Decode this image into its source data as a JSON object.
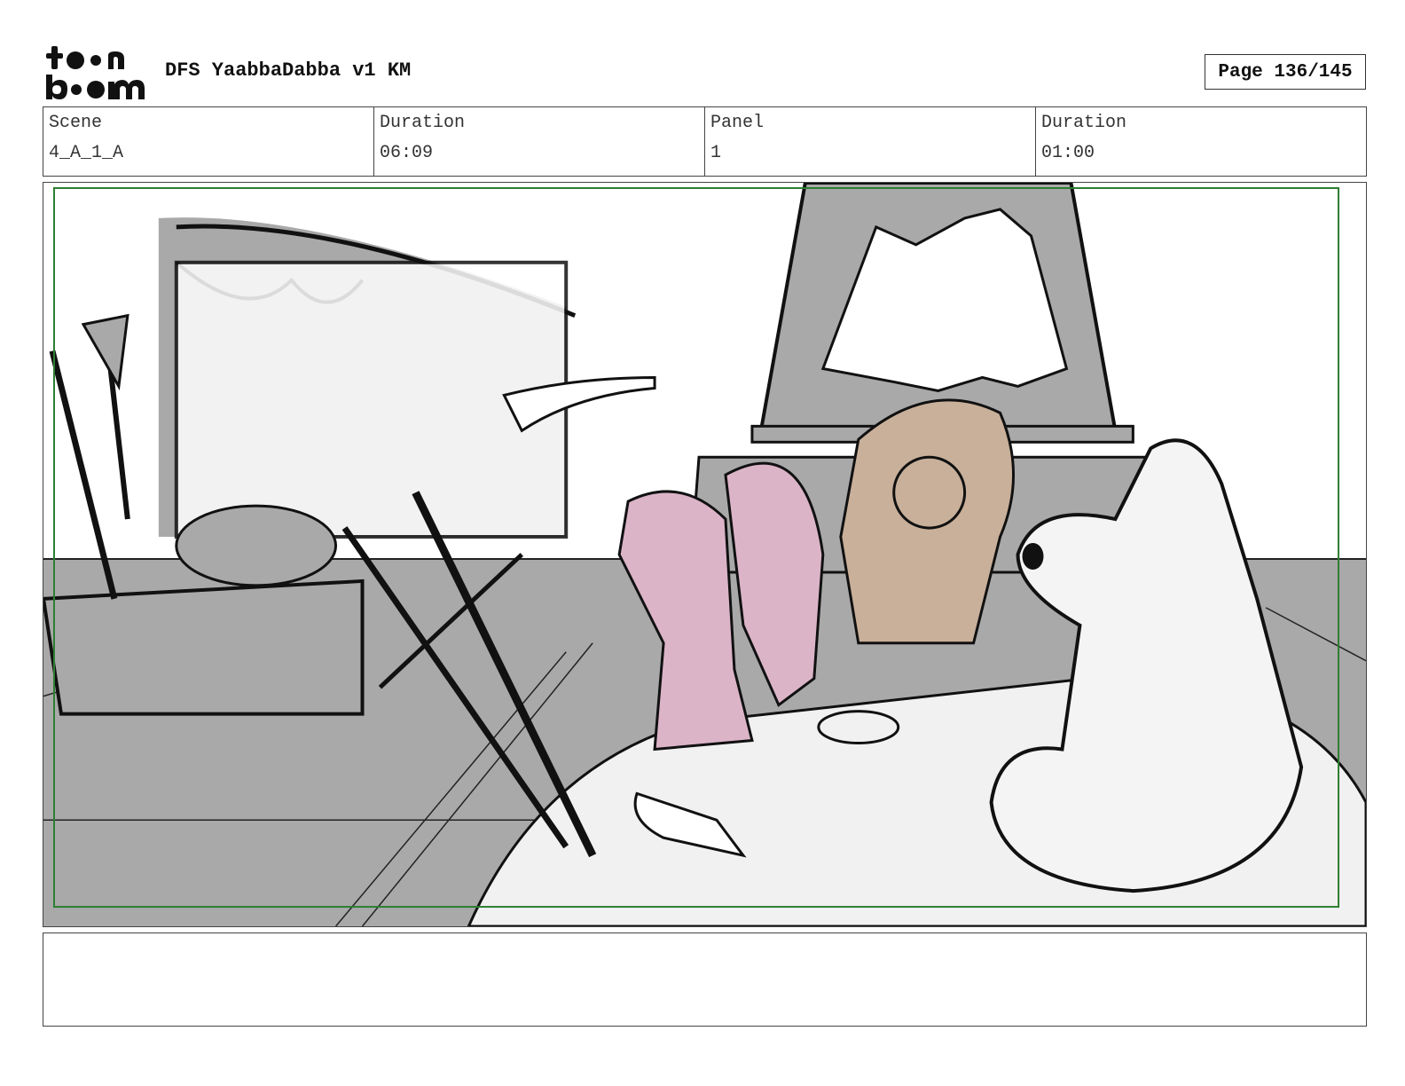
{
  "header": {
    "logo_text": "toon boom",
    "title": "DFS YaabbaDabba v1 KM",
    "page_label": "Page 136/145"
  },
  "info": {
    "scene_label": "Scene",
    "scene_value": "4_A_1_A",
    "scene_duration_label": "Duration",
    "scene_duration_value": "06:09",
    "panel_label": "Panel",
    "panel_value": "1",
    "panel_duration_label": "Duration",
    "panel_duration_value": "01:00"
  },
  "notes": {
    "text": ""
  },
  "colors": {
    "safe_frame": "#2e7d32",
    "sketch_gray": "#a9a9a9",
    "pink_character": "#dcb4c8",
    "tan_character": "#c9b09a",
    "line": "#111111"
  }
}
